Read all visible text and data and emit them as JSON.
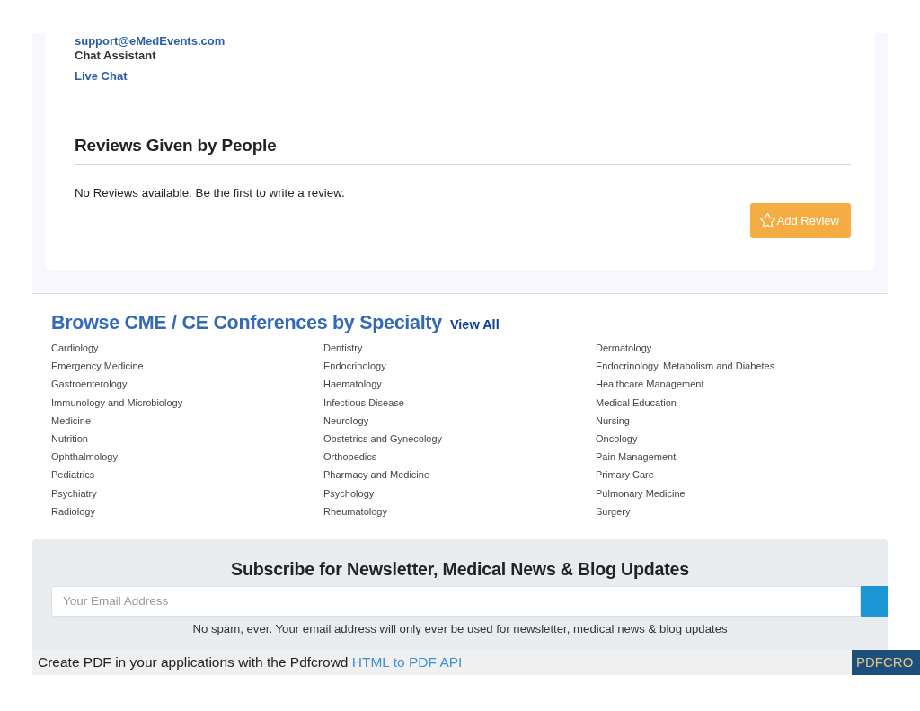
{
  "contact": {
    "email": "support@eMedEvents.com",
    "chat_label": "Chat Assistant",
    "chat_link": "Live Chat"
  },
  "reviews": {
    "title": "Reviews Given by People",
    "empty_message": "No Reviews available. Be the first to write a review.",
    "add_button": "Add Review"
  },
  "specialties": {
    "title": "Browse CME / CE Conferences by Specialty",
    "view_all": "View All",
    "items": [
      "Cardiology",
      "Dentistry",
      "Dermatology",
      "Emergency Medicine",
      "Endocrinology",
      "Endocrinology, Metabolism and Diabetes",
      "Gastroenterology",
      "Haematology",
      "Healthcare Management",
      "Immunology and Microbiology",
      "Infectious Disease",
      "Medical Education",
      "Medicine",
      "Neurology",
      "Nursing",
      "Nutrition",
      "Obstetrics and Gynecology",
      "Oncology",
      "Ophthalmology",
      "Orthopedics",
      "Pain Management",
      "Pediatrics",
      "Pharmacy and Medicine",
      "Primary Care",
      "Psychiatry",
      "Psychology",
      "Pulmonary Medicine",
      "Radiology",
      "Rheumatology",
      "Surgery"
    ]
  },
  "subscribe": {
    "title": "Subscribe for Newsletter, Medical News & Blog Updates",
    "email": {
      "placeholder": "Your Email Address"
    },
    "note": "No spam, ever. Your email address will only ever be used for newsletter, medical news & blog updates"
  },
  "pdf_banner": {
    "text": "Create PDF in your applications with the Pdfcrowd",
    "link": "HTML to PDF API",
    "logo": "PDFCRO"
  }
}
